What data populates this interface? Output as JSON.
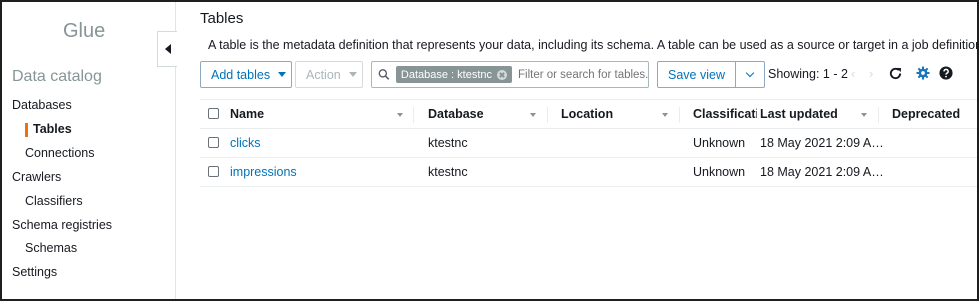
{
  "sidebar": {
    "brand": "Glue",
    "section_title": "Data catalog",
    "items": [
      {
        "label": "Databases"
      },
      {
        "label": "Tables"
      },
      {
        "label": "Connections"
      },
      {
        "label": "Crawlers"
      },
      {
        "label": "Classifiers"
      },
      {
        "label": "Schema registries"
      },
      {
        "label": "Schemas"
      },
      {
        "label": "Settings"
      }
    ],
    "active_item": "Tables"
  },
  "main": {
    "title": "Tables",
    "description": "A table is the metadata definition that represents your data, including its schema. A table can be used as a source or target in a job definition.",
    "toolbar": {
      "add_tables_label": "Add tables",
      "action_label": "Action",
      "filter_chip": "Database : ktestnc",
      "search_placeholder": "Filter or search for tables...",
      "save_view_label": "Save view",
      "showing": "Showing: 1 - 2"
    },
    "columns": [
      "Name",
      "Database",
      "Location",
      "Classificati",
      "Last updated",
      "Deprecated"
    ],
    "rows": [
      {
        "name": "clicks",
        "database": "ktestnc",
        "location": "",
        "classification": "Unknown",
        "last_updated": "18 May 2021 2:09 A…",
        "deprecated": ""
      },
      {
        "name": "impressions",
        "database": "ktestnc",
        "location": "",
        "classification": "Unknown",
        "last_updated": "18 May 2021 2:09 A…",
        "deprecated": ""
      }
    ]
  },
  "icons": {
    "collapse": "caret-left-icon",
    "search": "search-icon",
    "refresh": "refresh-icon",
    "settings": "gear-icon",
    "help": "help-icon"
  },
  "colors": {
    "accent_link": "#0073bb",
    "active_marker": "#ec7211",
    "settings_icon": "#1b75bb"
  }
}
